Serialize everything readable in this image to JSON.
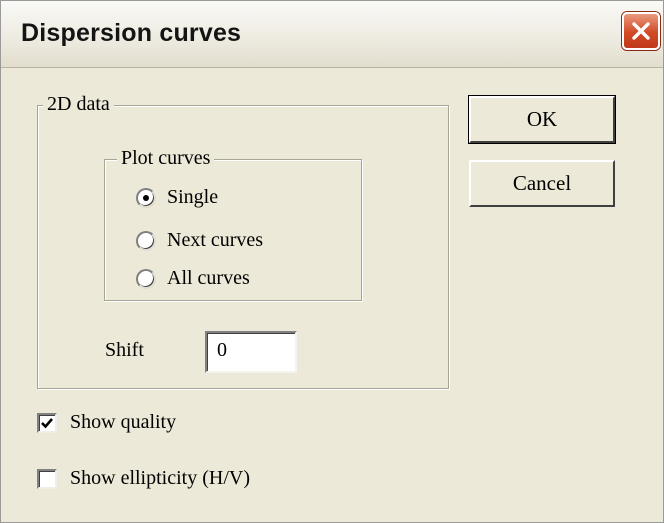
{
  "window": {
    "title": "Dispersion curves"
  },
  "group_2d": {
    "legend": "2D data",
    "plot_curves": {
      "legend": "Plot curves",
      "options": [
        "Single",
        "Next curves",
        "All curves"
      ],
      "selected": "Single"
    },
    "shift": {
      "label": "Shift",
      "value": "0"
    }
  },
  "buttons": {
    "ok": "OK",
    "cancel": "Cancel"
  },
  "checkboxes": {
    "show_quality": {
      "label": "Show quality",
      "checked": true
    },
    "show_ellipticity": {
      "label": "Show ellipticity (H/V)",
      "checked": false
    }
  },
  "icons": {
    "close": "close-icon",
    "check": "checkmark-icon"
  },
  "colors": {
    "dialog_bg": "#ece9d8",
    "close_button": "#d24a25"
  }
}
